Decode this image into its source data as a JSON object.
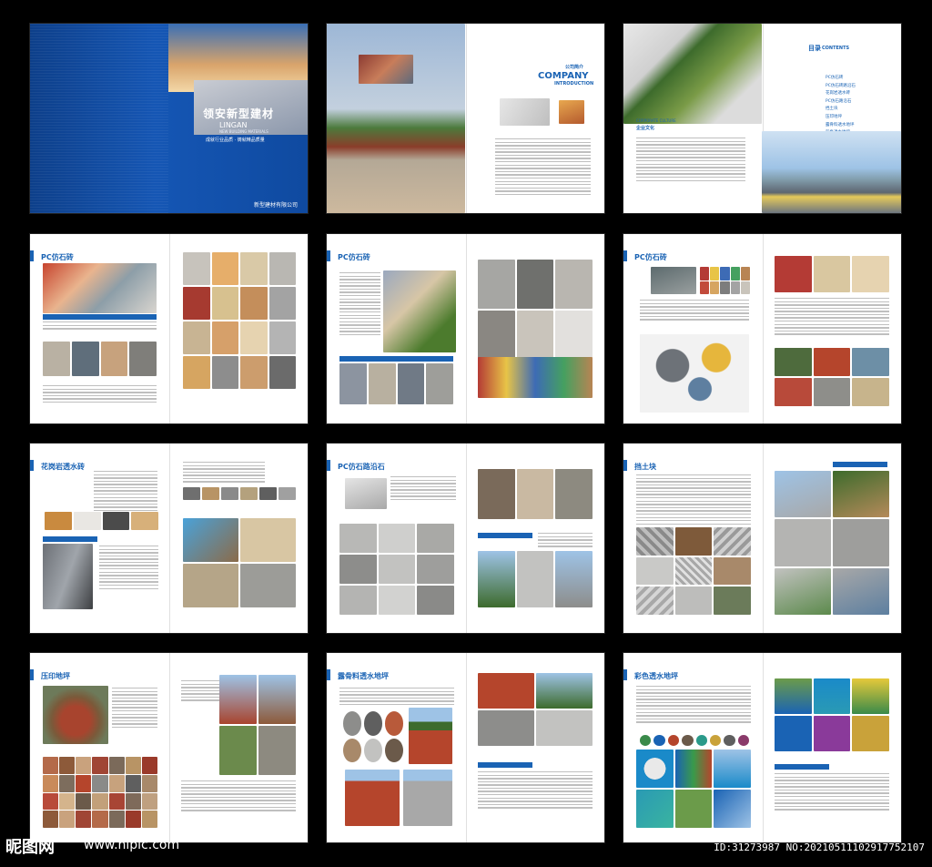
{
  "cover": {
    "brand": "领安新型建材",
    "name_en": "LINGAN",
    "subtitle_en": "NEW BUILDING MATERIALS",
    "slogan": "成就行业品质 · 铸就精品质量",
    "company": "新型建材有限公司"
  },
  "intro": {
    "tag": "公司简介",
    "title_1": "COMPANY",
    "title_2": "INTRODUCTION",
    "culture_en": "CORPORATE CULTURE",
    "culture": "企业文化"
  },
  "toc": {
    "title": "目录",
    "title_en": "CONTENTS",
    "items": [
      "PC仿石砖",
      "PC仿石砖路沿石",
      "花岗岩透水砖",
      "PC仿石路沿石",
      "挡土块",
      "压印地坪",
      "露骨料透水地坪",
      "彩色透水地坪",
      "MPV透水砖",
      "CPVC透水地坪"
    ]
  },
  "sections": {
    "s1": "PC仿石砖",
    "s2": "PC仿石砖",
    "s3": "PC仿石砖",
    "s4": "花岗岩透水砖",
    "s5": "PC仿石路沿石",
    "s6": "挡土块",
    "s7": "压印地坪",
    "s8": "露骨料透水地坪",
    "s9": "彩色透水地坪"
  },
  "watermark": {
    "logo": "昵图网",
    "url": "www.nipic.com",
    "id": "ID:31273987 NO:20210511102917752107"
  },
  "colors": {
    "brand_blue": "#1a63b4",
    "cover_blue": "#0f4aa0"
  }
}
